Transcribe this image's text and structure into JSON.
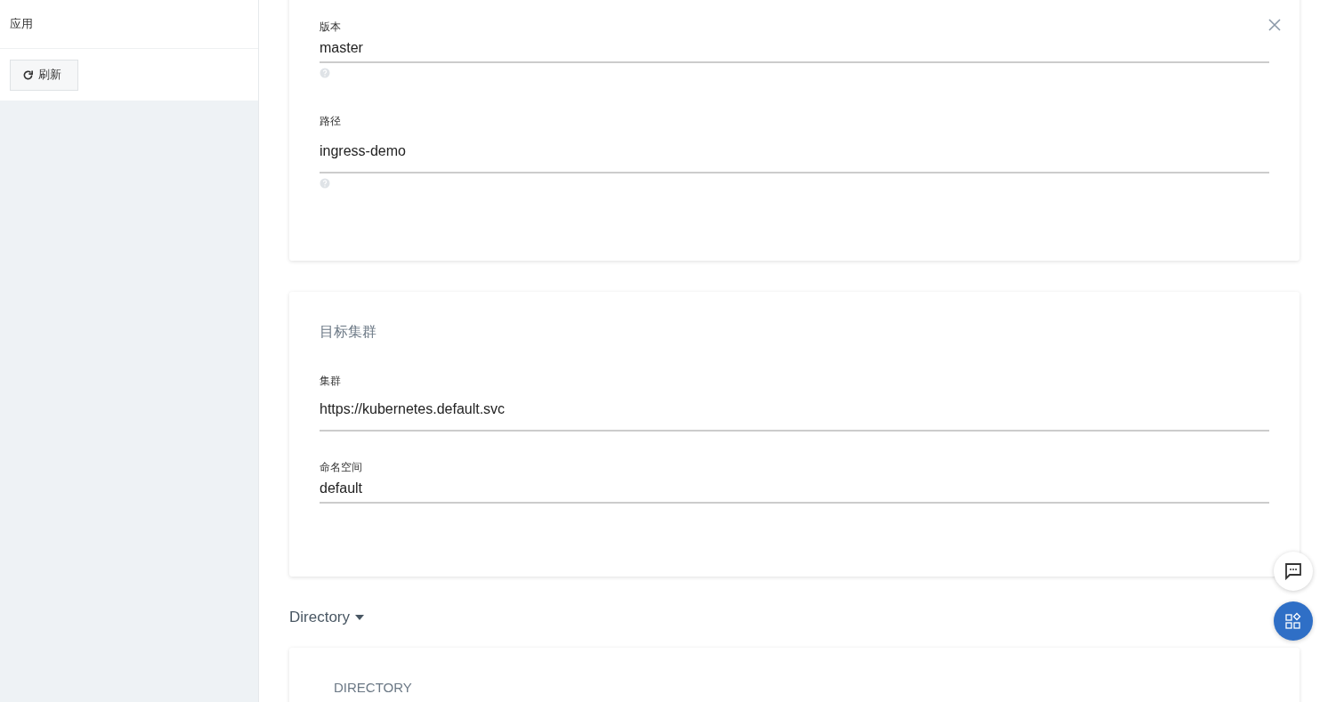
{
  "sidebar": {
    "title": "应用",
    "refresh_button": "刷新"
  },
  "source_card": {
    "fields": [
      {
        "label": "版本",
        "value": "master",
        "help": true
      },
      {
        "label": "路径",
        "value": "ingress-demo",
        "help": true
      }
    ]
  },
  "destination_card": {
    "title": "目标集群",
    "fields": [
      {
        "label": "集群",
        "value": "https://kubernetes.default.svc"
      },
      {
        "label": "命名空间",
        "value": "default"
      }
    ]
  },
  "directory_toggle": {
    "label": "Directory",
    "expanded": false
  },
  "directory_card": {
    "title": "DIRECTORY"
  }
}
